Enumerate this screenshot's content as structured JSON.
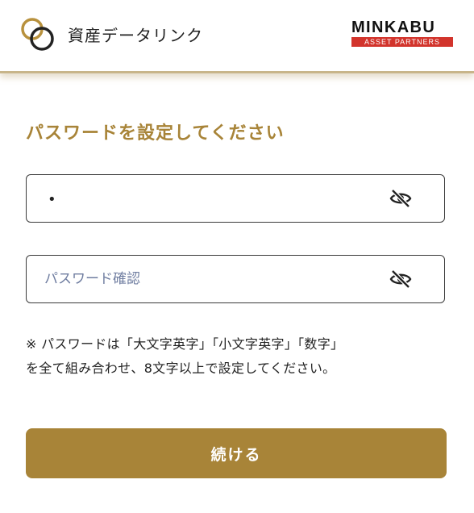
{
  "header": {
    "app_title": "資産データリンク",
    "brand_name": "MINKABU",
    "brand_sub": "ASSET PARTNERS"
  },
  "form": {
    "title": "パスワードを設定してください",
    "password_value": "•",
    "confirm_placeholder": "パスワード確認",
    "note_line1": "※ パスワードは「大文字英字」「小文字英字」「数字」",
    "note_line2": "を全て組み合わせ、8文字以上で設定してください。",
    "submit_label": "続ける"
  },
  "icons": {
    "visibility": "eye-slash-icon"
  },
  "colors": {
    "accent": "#a88438",
    "brand_red": "#d2342c",
    "placeholder": "#6f7da0"
  }
}
